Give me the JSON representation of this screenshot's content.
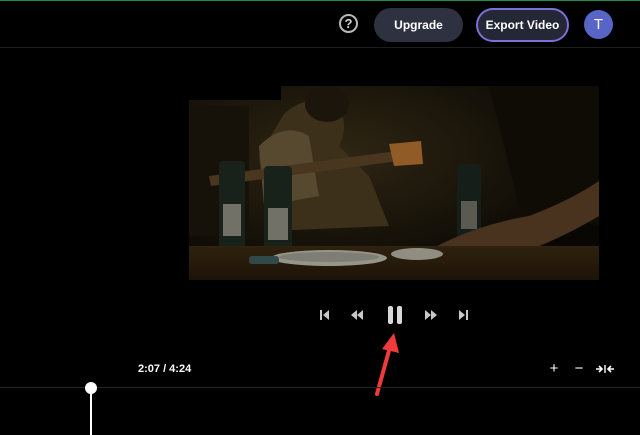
{
  "header": {
    "help_icon": "help-circle-icon",
    "help_glyph": "?",
    "upgrade_label": "Upgrade",
    "export_label": "Export Video",
    "avatar_initial": "T",
    "accent_color": "#7e6fd6",
    "avatar_color": "#5865c6"
  },
  "player": {
    "controls": [
      "skip-back-icon",
      "rewind-icon",
      "pause-icon",
      "fast-forward-icon",
      "skip-forward-icon"
    ]
  },
  "timeline": {
    "timecode": "2:07 / 4:24",
    "zoom_in_glyph": "+",
    "zoom_out_glyph": "−",
    "fit_icon": "fit-to-screen-icon"
  },
  "annotation": {
    "arrow_color": "#ef3b3b"
  }
}
